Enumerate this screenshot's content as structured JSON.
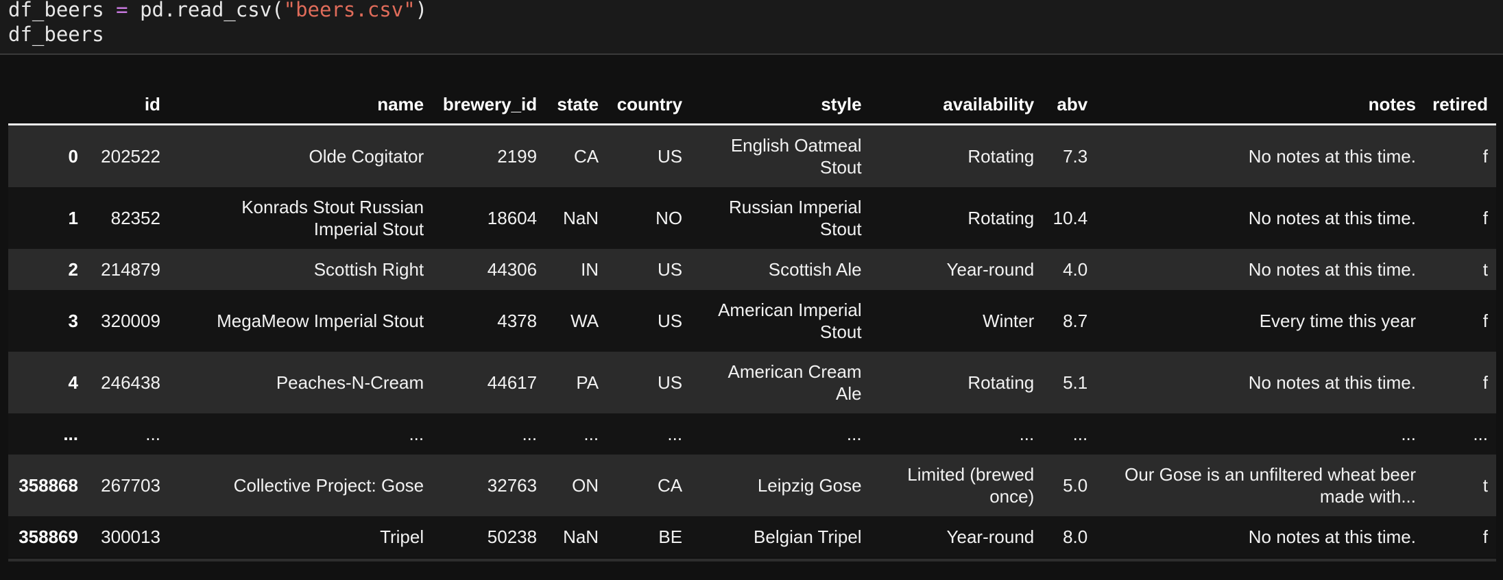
{
  "code": {
    "line1_var": "df_beers",
    "line1_op": "=",
    "line1_call": "pd.read_csv(",
    "line1_arg": "\"beers.csv\"",
    "line1_close": ")",
    "line2": "df_beers"
  },
  "table": {
    "columns": [
      "",
      "id",
      "name",
      "brewery_id",
      "state",
      "country",
      "style",
      "availability",
      "abv",
      "notes",
      "retired"
    ],
    "rows": [
      {
        "index": "0",
        "id": "202522",
        "name": "Olde Cogitator",
        "brewery_id": "2199",
        "state": "CA",
        "country": "US",
        "style": "English Oatmeal Stout",
        "availability": "Rotating",
        "abv": "7.3",
        "notes": "No notes at this time.",
        "retired": "f"
      },
      {
        "index": "1",
        "id": "82352",
        "name": "Konrads Stout Russian Imperial Stout",
        "brewery_id": "18604",
        "state": "NaN",
        "country": "NO",
        "style": "Russian Imperial Stout",
        "availability": "Rotating",
        "abv": "10.4",
        "notes": "No notes at this time.",
        "retired": "f"
      },
      {
        "index": "2",
        "id": "214879",
        "name": "Scottish Right",
        "brewery_id": "44306",
        "state": "IN",
        "country": "US",
        "style": "Scottish Ale",
        "availability": "Year-round",
        "abv": "4.0",
        "notes": "No notes at this time.",
        "retired": "t"
      },
      {
        "index": "3",
        "id": "320009",
        "name": "MegaMeow Imperial Stout",
        "brewery_id": "4378",
        "state": "WA",
        "country": "US",
        "style": "American Imperial Stout",
        "availability": "Winter",
        "abv": "8.7",
        "notes": "Every time this year",
        "retired": "f"
      },
      {
        "index": "4",
        "id": "246438",
        "name": "Peaches-N-Cream",
        "brewery_id": "44617",
        "state": "PA",
        "country": "US",
        "style": "American Cream Ale",
        "availability": "Rotating",
        "abv": "5.1",
        "notes": "No notes at this time.",
        "retired": "f"
      },
      {
        "index": "...",
        "id": "...",
        "name": "...",
        "brewery_id": "...",
        "state": "...",
        "country": "...",
        "style": "...",
        "availability": "...",
        "abv": "...",
        "notes": "...",
        "retired": "..."
      },
      {
        "index": "358868",
        "id": "267703",
        "name": "Collective Project: Gose",
        "brewery_id": "32763",
        "state": "ON",
        "country": "CA",
        "style": "Leipzig Gose",
        "availability": "Limited (brewed once)",
        "abv": "5.0",
        "notes": "Our Gose is an unfiltered wheat beer made with...",
        "retired": "t"
      },
      {
        "index": "358869",
        "id": "300013",
        "name": "Tripel",
        "brewery_id": "50238",
        "state": "NaN",
        "country": "BE",
        "style": "Belgian Tripel",
        "availability": "Year-round",
        "abv": "8.0",
        "notes": "No notes at this time.",
        "retired": "f"
      }
    ]
  }
}
